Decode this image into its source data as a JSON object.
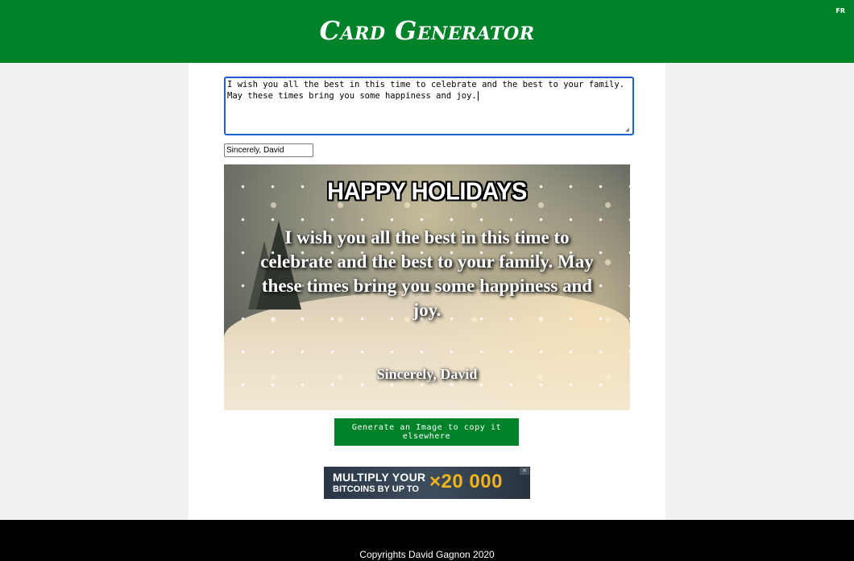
{
  "header": {
    "title": "Card Generator",
    "lang_toggle": "FR",
    "bg_color": "#008228"
  },
  "form": {
    "message_value": "I wish you all the best in this time to celebrate and the best to your family.\nMay these times bring you some happiness and joy.",
    "signature_value": "Sincerely, David"
  },
  "card": {
    "heading": "HAPPY HOLIDAYS",
    "body": "I wish you all the best in this time to celebrate and the best to your family. May these times bring you some happiness and joy.",
    "signature": "Sincerely, David"
  },
  "actions": {
    "generate_label": "Generate an Image to copy it elsewhere",
    "button_color": "#008228"
  },
  "ad": {
    "line1": "MULTIPLY YOUR",
    "line2": "BITCOINS BY UP TO",
    "multiplier": "×20 000",
    "close_icon": "close-icon"
  },
  "footer": {
    "copyright": "Copyrights David Gagnon 2020"
  }
}
